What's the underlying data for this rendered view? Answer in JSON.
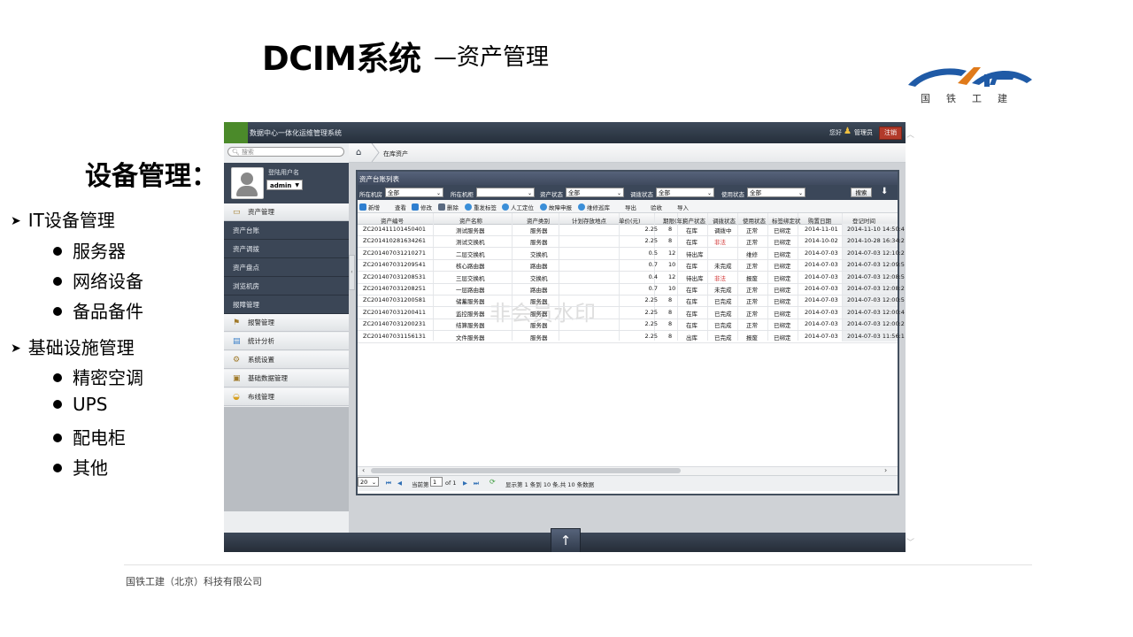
{
  "slide": {
    "title": "DCIM系统",
    "subtitle": "—资产管理",
    "logo_text": "国铁工建",
    "section_heading": "设备管理：",
    "footer": "国铁工建（北京）科技有限公司",
    "bullets": [
      {
        "text": "IT设备管理",
        "children": [
          "服务器",
          "网络设备",
          "备品备件"
        ]
      },
      {
        "text": "基础设施管理",
        "children": [
          "精密空调",
          "UPS",
          "配电柜",
          "其他"
        ]
      }
    ]
  },
  "app": {
    "title": "数据中心一体化运维管理系统",
    "greeting": "您好",
    "username": "管理员",
    "logout": "注销",
    "search_placeholder": "搜索",
    "login_label": "登陆用户名",
    "login_value": "admin",
    "breadcrumb": "在库资产",
    "sidebar": {
      "asset_menu": "资产管理",
      "asset_sub": [
        "资产台账",
        "资产调拨",
        "资产盘点",
        "浏览机房",
        "报障管理"
      ],
      "other_menus": [
        "报警管理",
        "统计分析",
        "系统设置",
        "基础数据管理",
        "布线管理"
      ]
    },
    "panel_title": "资产台账列表",
    "filters": [
      {
        "label": "所在机房",
        "value": "全部"
      },
      {
        "label": "所在机柜",
        "value": ""
      },
      {
        "label": "资产状态",
        "value": "全部"
      },
      {
        "label": "调拨状态",
        "value": "全部"
      },
      {
        "label": "使用状态",
        "value": "全部"
      }
    ],
    "search_button": "搜索",
    "toolbar": [
      "新增",
      "查看",
      "修改",
      "删除",
      "重发标签",
      "人工定位",
      "故障申报",
      "维修巡库",
      "导出",
      "验收",
      "导入"
    ],
    "columns": [
      "资产编号",
      "资产名称",
      "资产类别",
      "计划存放地点",
      "单价(元)",
      "期限(年)",
      "资产状态",
      "调拨状态",
      "使用状态",
      "标签绑定状",
      "购置日期",
      "登记时间"
    ],
    "rows": [
      [
        "ZC201411101450401",
        "测试服务器",
        "服务器",
        "",
        "2.25",
        "8",
        "在库",
        "调拨中",
        "正常",
        "已绑定",
        "2014-11-01",
        "2014-11-10 14:50:4"
      ],
      [
        "ZC201410281634261",
        "测试交换机",
        "服务器",
        "",
        "2.25",
        "8",
        "在库",
        "非法",
        "正常",
        "已绑定",
        "2014-10-02",
        "2014-10-28 16:34:2"
      ],
      [
        "ZC201407031210271",
        "二层交换机",
        "交换机",
        "",
        "0.5",
        "12",
        "待出库",
        "",
        "维修",
        "已绑定",
        "2014-07-03",
        "2014-07-03 12:10:2"
      ],
      [
        "ZC201407031209541",
        "核心路由器",
        "路由器",
        "",
        "0.7",
        "10",
        "在库",
        "未完成",
        "正常",
        "已绑定",
        "2014-07-03",
        "2014-07-03 12:09:5"
      ],
      [
        "ZC201407031208531",
        "三层交换机",
        "交换机",
        "",
        "0.4",
        "12",
        "待出库",
        "非法",
        "报废",
        "已绑定",
        "2014-07-03",
        "2014-07-03 12:08:5"
      ],
      [
        "ZC201407031208251",
        "一层路由器",
        "路由器",
        "",
        "0.7",
        "10",
        "在库",
        "未完成",
        "正常",
        "已绑定",
        "2014-07-03",
        "2014-07-03 12:08:2"
      ],
      [
        "ZC201407031200581",
        "储蓄服务器",
        "服务器",
        "",
        "2.25",
        "8",
        "在库",
        "已完成",
        "正常",
        "已绑定",
        "2014-07-03",
        "2014-07-03 12:00:5"
      ],
      [
        "ZC201407031200411",
        "监控服务器",
        "服务器",
        "",
        "2.25",
        "8",
        "在库",
        "已完成",
        "正常",
        "已绑定",
        "2014-07-03",
        "2014-07-03 12:00:4"
      ],
      [
        "ZC201407031200231",
        "结算服务器",
        "服务器",
        "",
        "2.25",
        "8",
        "在库",
        "已完成",
        "正常",
        "已绑定",
        "2014-07-03",
        "2014-07-03 12:00:2"
      ],
      [
        "ZC201407031156131",
        "文件服务器",
        "服务器",
        "",
        "2.25",
        "8",
        "出库",
        "已完成",
        "报废",
        "已绑定",
        "2014-07-03",
        "2014-07-03 11:56:1"
      ]
    ],
    "pager": {
      "page_size": "20",
      "page_label": "当前第",
      "page_value": "1",
      "of": "of 1",
      "summary": "显示第 1 条到 10 条,共 10 条数据"
    },
    "watermark": "非会员水印"
  },
  "colors": {
    "header_dark": "#262f3b",
    "sidebar_dark": "#3b4656",
    "red_status": "#d03030",
    "logo_blue": "#1f5aa6",
    "logo_orange": "#e07a1a"
  }
}
